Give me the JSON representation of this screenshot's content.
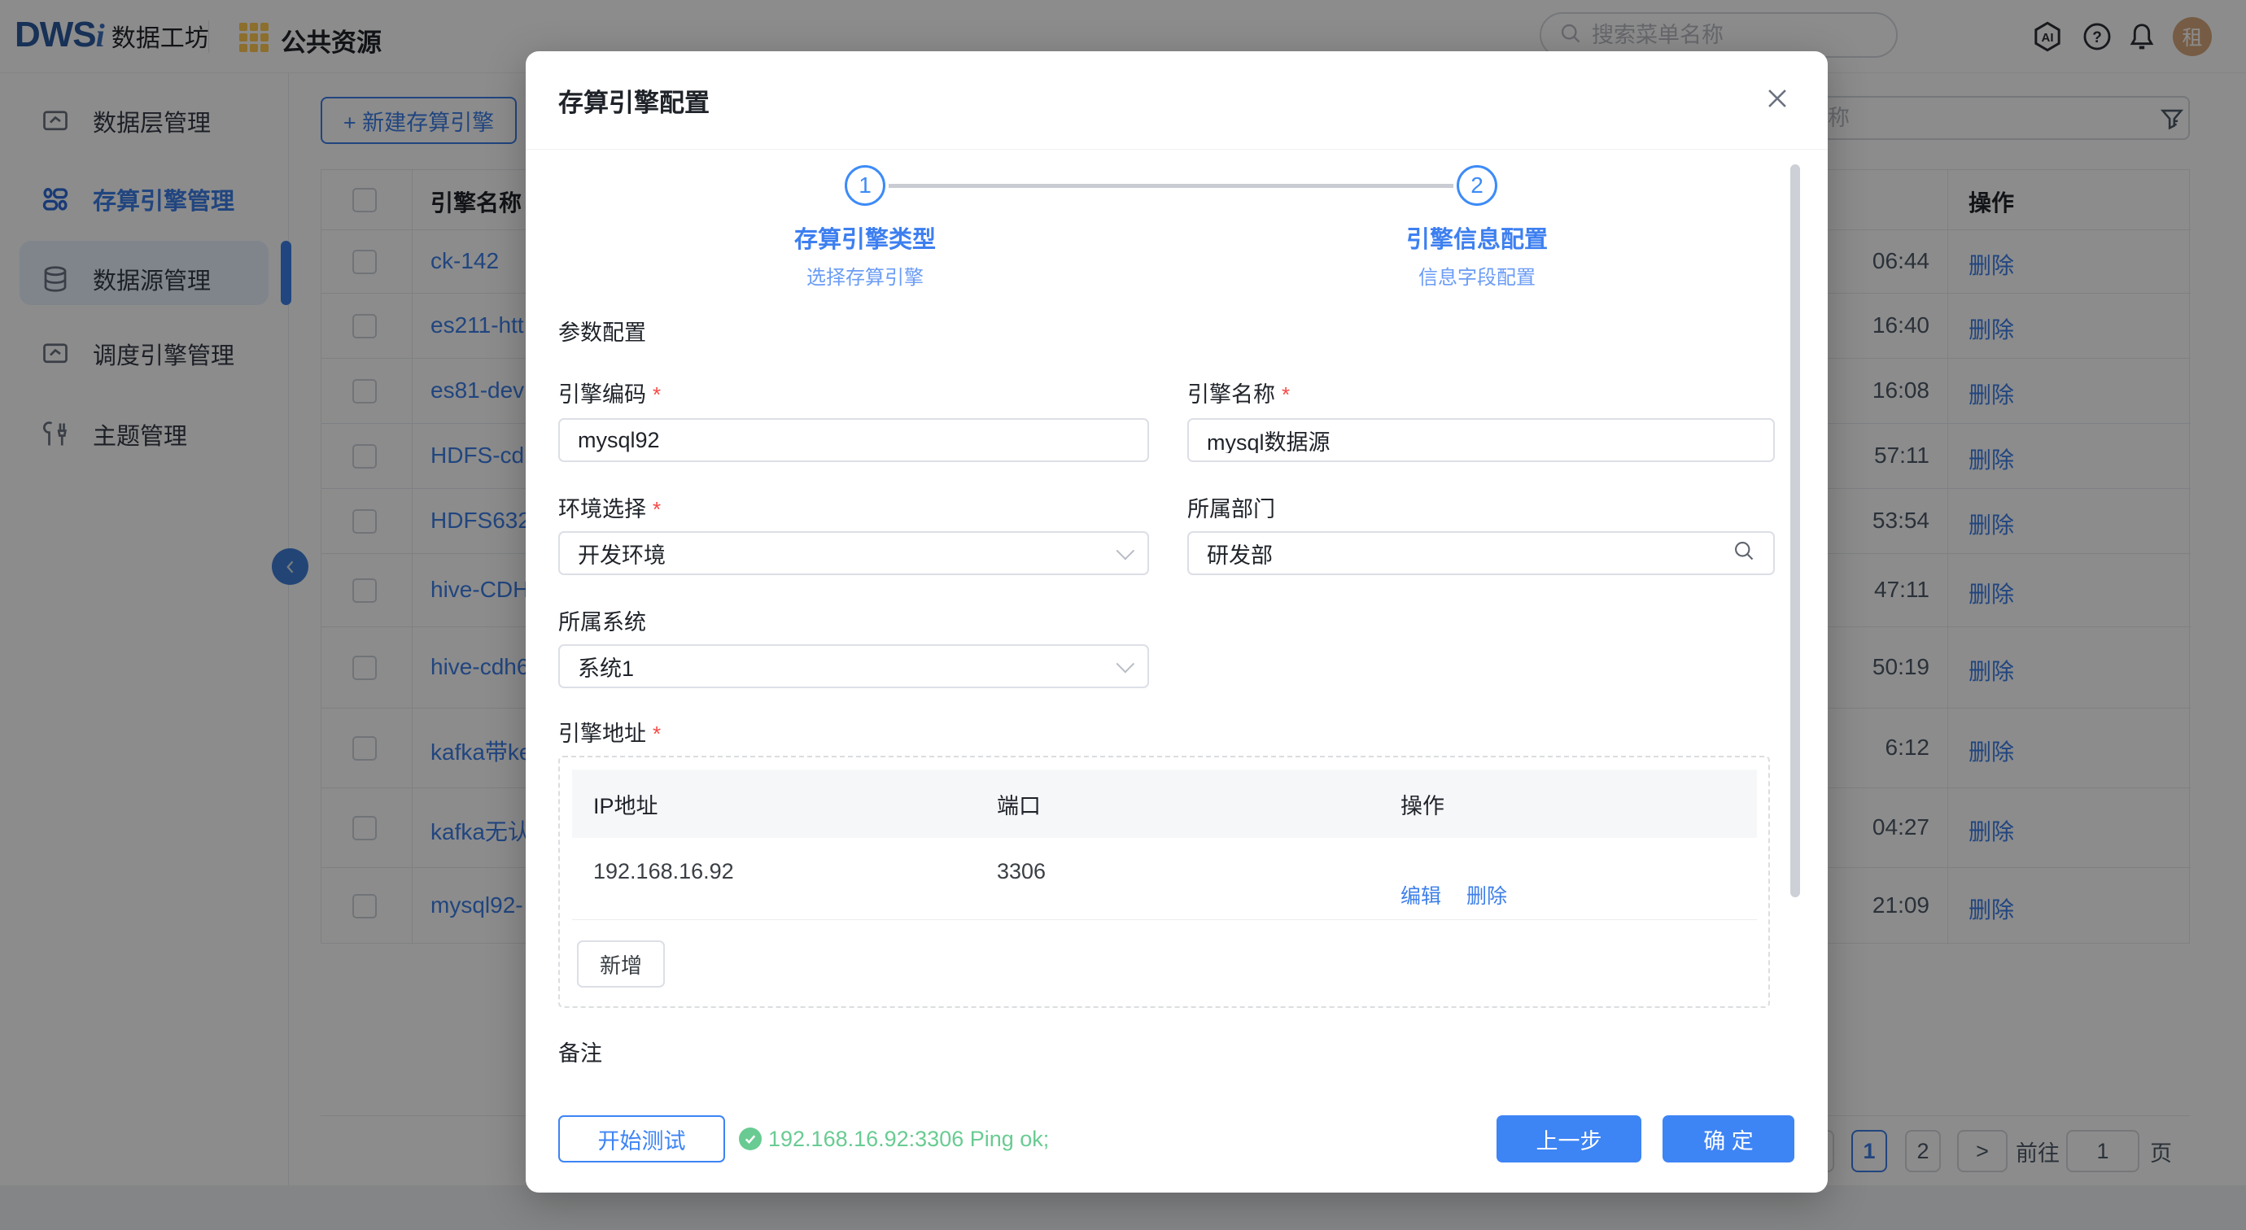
{
  "colors": {
    "primary_blue": "#3D84F5",
    "link_blue": "#3D7FE8",
    "success_green": "#69CB92",
    "required_red": "#F54A45",
    "brand_gold": "#FFC852",
    "sidebar_active_bg": "#E9F2FF"
  },
  "header": {
    "logo_dws": "DWS",
    "logo_i": "i",
    "logo_product": "数据工坊",
    "app_name": "公共资源",
    "search_placeholder": "搜索菜单名称",
    "avatar_text": "租"
  },
  "sidebar": {
    "items": [
      {
        "label": "数据层管理"
      },
      {
        "label": "存算引擎管理",
        "active": true
      },
      {
        "label": "数据源管理"
      },
      {
        "label": "调度引擎管理"
      },
      {
        "label": "主题管理"
      }
    ]
  },
  "toolbar": {
    "new_engine_button": "+ 新建存算引擎",
    "filter_placeholder": "请输入引擎名称"
  },
  "table": {
    "name_header": "引擎名称",
    "action_header": "操作",
    "delete_label": "删除",
    "rows": [
      {
        "name": "ck-142",
        "time": "06:44"
      },
      {
        "name": "es211-htt",
        "time": "16:40"
      },
      {
        "name": "es81-dev",
        "time": "16:08"
      },
      {
        "name": "HDFS-cd",
        "time": "57:11"
      },
      {
        "name": "HDFS632",
        "time": "53:54"
      },
      {
        "name": "hive-CDH",
        "time": "47:11"
      },
      {
        "name": "hive-cdh6",
        "time": "50:19"
      },
      {
        "name": "kafka带ke",
        "time": "6:12"
      },
      {
        "name": "kafka无认",
        "time": "04:27"
      },
      {
        "name": "mysql92-",
        "time": "21:09"
      }
    ]
  },
  "pagination": {
    "page1": "1",
    "page2": "2",
    "next": ">",
    "goto_label": "前往",
    "goto_value": "1",
    "unit_label": "页"
  },
  "modal": {
    "title": "存算引擎配置",
    "required_mark": "*",
    "steps": [
      {
        "num": "1",
        "title": "存算引擎类型",
        "subtitle": "选择存算引擎"
      },
      {
        "num": "2",
        "title": "引擎信息配置",
        "subtitle": "信息字段配置"
      }
    ],
    "section_title": "参数配置",
    "engine_code_label": "引擎编码",
    "engine_code_value": "mysql92",
    "engine_name_label": "引擎名称",
    "engine_name_value": "mysql数据源",
    "env_label": "环境选择",
    "env_value": "开发环境",
    "dept_label": "所属部门",
    "dept_value": "研发部",
    "system_label": "所属系统",
    "system_value": "系统1",
    "address_label": "引擎地址",
    "address_table": {
      "col_ip": "IP地址",
      "col_port": "端口",
      "col_action": "操作",
      "rows": [
        {
          "ip": "192.168.16.92",
          "port": "3306",
          "edit": "编辑",
          "delete": "删除"
        }
      ],
      "add_button": "新增"
    },
    "remark_label": "备注",
    "footer": {
      "test_button": "开始测试",
      "test_result": "192.168.16.92:3306 Ping ok;",
      "prev_button": "上一步",
      "confirm_button": "确 定"
    }
  }
}
